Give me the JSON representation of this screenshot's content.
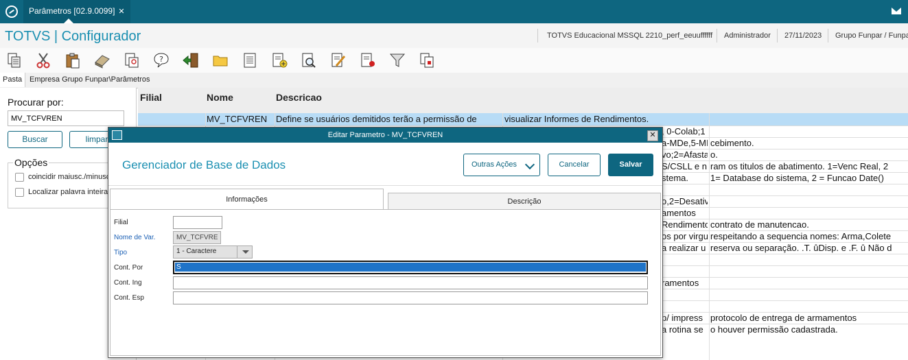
{
  "topbar": {
    "tab_label": "Parâmetros [02.9.0099]",
    "tab_close": "✕"
  },
  "header": {
    "app_title": "TOTVS | Configurador",
    "environment": "TOTVS Educacional MSSQL 2210_perf_eeuuffffff",
    "user": "Administrador",
    "date": "27/11/2023",
    "company": "Grupo Funpar / Funpar"
  },
  "tabs": {
    "pasta": "Pasta",
    "path": "Empresa Grupo Funpar\\Parâmetros"
  },
  "left": {
    "procurar_label": "Procurar por:",
    "search_value": "MV_TCFVREN",
    "buscar": "Buscar",
    "limpar": "limpar",
    "opcoes": "Opções",
    "opt1": "coincidir maiusc./minusc.",
    "opt2": "Localizar palavra inteira"
  },
  "grid": {
    "headers": {
      "filial": "Filial",
      "nome": "Nome",
      "descricao": "Descricao"
    },
    "sel_nome": "MV_TCFVREN",
    "sel_desc": "Define se usuários demitidos terão a permissão de",
    "sel_desc2": "visualizar Informes de Rendimentos.",
    "frag": [
      {
        "a": ", 0-Colab;1",
        "b": ""
      },
      {
        "a": "a-MDe,5-MI",
        "b": "cebimento."
      },
      {
        "a": "vo;2=Afasta",
        "b": "o."
      },
      {
        "a": "S/CSLL e n",
        "b": "ram os titulos de abatimento. 1=Venc Real, 2"
      },
      {
        "a": "stema.",
        "b": "1= Database do sistema, 2 = Funcao Date()"
      },
      {
        "a": "",
        "b": ""
      },
      {
        "a": "o,2=Desativ",
        "b": ""
      },
      {
        "a": "amentos",
        "b": ""
      },
      {
        "a": "Rendimento",
        "b": "contrato de manutencao."
      },
      {
        "a": "os por virgu",
        "b": "respeitando a sequencia nomes: Arma,Colete"
      },
      {
        "a": "a realizar u",
        "b": "reserva ou separação. .T. ûDisp. e .F. û Não d"
      },
      {
        "a": "",
        "b": ""
      },
      {
        "a": "",
        "b": ""
      },
      {
        "a": "ramentos",
        "b": ""
      },
      {
        "a": "",
        "b": ""
      },
      {
        "a": "",
        "b": ""
      },
      {
        "a": "p/ impress",
        "b": "protocolo de entrega de armamentos"
      },
      {
        "a": "a rotina se",
        "b": "o houver permissão cadastrada."
      }
    ]
  },
  "modal": {
    "title": "Editar Parametro - MV_TCFVREN",
    "subtitle": "Gerenciador de Base de Dados",
    "outras_acoes": "Outras Ações",
    "cancelar": "Cancelar",
    "salvar": "Salvar",
    "tab_info": "Informações",
    "tab_desc": "Descrição",
    "form": {
      "filial_label": "Filial",
      "filial_value": "",
      "nome_label": "Nome de Var.",
      "nome_value": "MV_TCFVRE",
      "tipo_label": "Tipo",
      "tipo_value": "1 - Caractere",
      "contpor_label": "Cont. Por",
      "contpor_value": "S",
      "conting_label": "Cont. Ing",
      "conting_value": "",
      "contesp_label": "Cont. Esp",
      "contesp_value": ""
    }
  }
}
